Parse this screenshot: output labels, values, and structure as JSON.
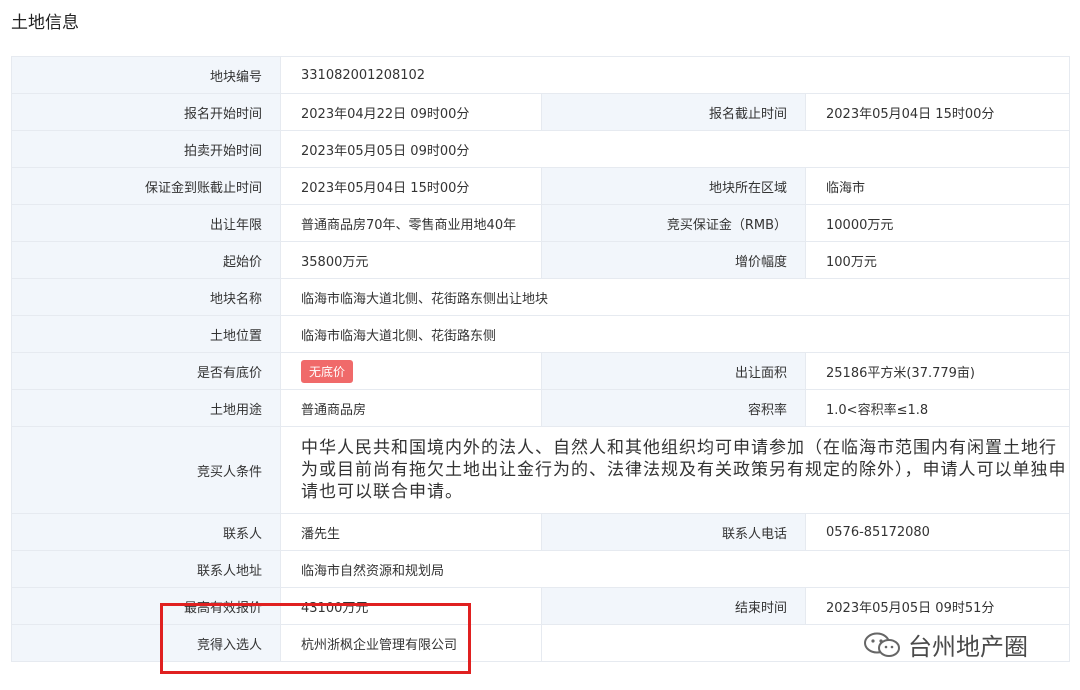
{
  "title": "土地信息",
  "rows": {
    "r1": {
      "l1": "地块编号",
      "v1": "331082001208102"
    },
    "r2": {
      "l1": "报名开始时间",
      "v1": "2023年04月22日 09时00分",
      "l2": "报名截止时间",
      "v2": "2023年05月04日 15时00分"
    },
    "r3": {
      "l1": "拍卖开始时间",
      "v1": "2023年05月05日 09时00分"
    },
    "r4": {
      "l1": "保证金到账截止时间",
      "v1": "2023年05月04日 15时00分",
      "l2": "地块所在区域",
      "v2": "临海市"
    },
    "r5": {
      "l1": "出让年限",
      "v1": "普通商品房70年、零售商业用地40年",
      "l2": "竞买保证金（RMB）",
      "v2": "10000万元"
    },
    "r6": {
      "l1": "起始价",
      "v1": "35800万元",
      "l2": "增价幅度",
      "v2": "100万元"
    },
    "r7": {
      "l1": "地块名称",
      "v1": "临海市临海大道北侧、花街路东侧出让地块"
    },
    "r8": {
      "l1": "土地位置",
      "v1": "临海市临海大道北侧、花街路东侧"
    },
    "r9": {
      "l1": "是否有底价",
      "badge": "无底价",
      "l2": "出让面积",
      "v2": "25186平方米(37.779亩)"
    },
    "r10": {
      "l1": "土地用途",
      "v1": "普通商品房",
      "l2": "容积率",
      "v2": "1.0<容积率≤1.8"
    },
    "r11": {
      "l1": "竞买人条件",
      "v1": "中华人民共和国境内外的法人、自然人和其他组织均可申请参加（在临海市范围内有闲置土地行为或目前尚有拖欠土地出让金行为的、法律法规及有关政策另有规定的除外），申请人可以单独申请也可以联合申请。"
    },
    "r12": {
      "l1": "联系人",
      "v1": "潘先生",
      "l2": "联系人电话",
      "v2": "0576-85172080"
    },
    "r13": {
      "l1": "联系人地址",
      "v1": "临海市自然资源和规划局"
    },
    "r14": {
      "l1": "最高有效报价",
      "v1": "43100万元",
      "l2": "结束时间",
      "v2": "2023年05月05日 09时51分"
    },
    "r15": {
      "l1": "竞得入选人",
      "v1": "杭州浙枫企业管理有限公司"
    }
  },
  "watermark": {
    "text": "台州地产圈",
    "icon": "wechat-icon"
  },
  "colors": {
    "label_bg": "#f2f6fb",
    "badge": "#f06a6a",
    "highlight": "#e02020"
  }
}
